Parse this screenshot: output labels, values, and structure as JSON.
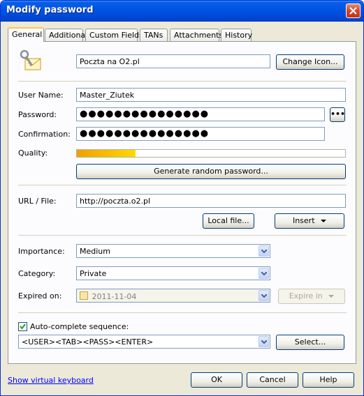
{
  "window": {
    "title": "Modify password"
  },
  "tabs": [
    {
      "label": "General",
      "active": true
    },
    {
      "label": "Additional"
    },
    {
      "label": "Custom Fields"
    },
    {
      "label": "TANs"
    },
    {
      "label": "Attachments"
    },
    {
      "label": "History"
    }
  ],
  "entry": {
    "title_value": "Poczta na O2.pl",
    "change_icon_label": "Change Icon...",
    "icon": "key-envelope-icon"
  },
  "fields": {
    "user_name_label": "User Name:",
    "user_name_value": "Master_Ziutek",
    "password_label": "Password:",
    "password_value": "●●●●●●●●●●●●●●●",
    "password_toggle_label": "•••",
    "confirmation_label": "Confirmation:",
    "confirmation_value": "●●●●●●●●●●●●●●●",
    "quality_label": "Quality:",
    "quality_level": 0.22,
    "generate_label": "Generate random password...",
    "url_label": "URL / File:",
    "url_value": "http://poczta.o2.pl",
    "local_file_label": "Local file...",
    "insert_label": "Insert"
  },
  "properties": {
    "importance_label": "Importance:",
    "importance_value": "Medium",
    "category_label": "Category:",
    "category_value": "Private",
    "expired_label": "Expired on:",
    "expired_value": "2011-11-04",
    "expire_in_label": "Expire in"
  },
  "autocomplete": {
    "label": "Auto-complete sequence:",
    "checked": true,
    "sequence": "<USER><TAB><PASS><ENTER>",
    "select_label": "Select..."
  },
  "footer": {
    "keyboard_link": "Show virtual keyboard",
    "ok_label": "OK",
    "cancel_label": "Cancel",
    "help_label": "Help"
  },
  "colors": {
    "titlebar": "#0055e5",
    "dialog_bg": "#ece9d8",
    "quality_fill": "#f0a000",
    "link": "#0000ff"
  }
}
